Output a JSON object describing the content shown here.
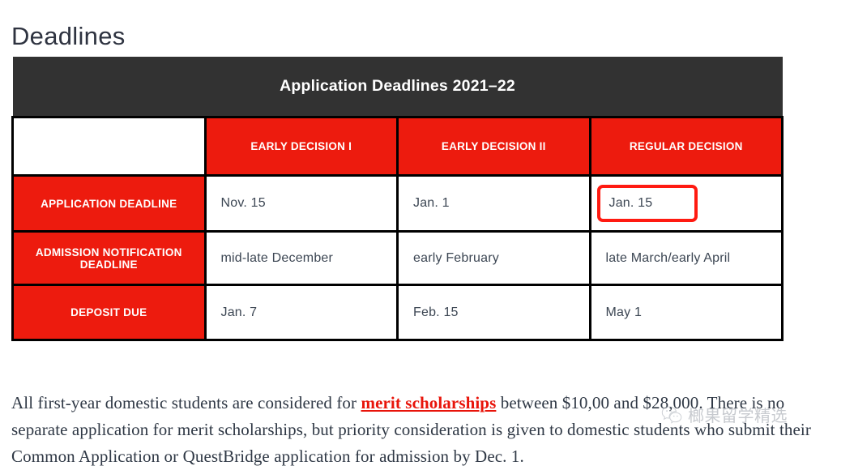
{
  "page": {
    "heading": "Deadlines"
  },
  "table": {
    "caption": "Application Deadlines 2021–22",
    "corner_label": "",
    "columns": [
      "EARLY DECISION I",
      "EARLY DECISION II",
      "REGULAR DECISION"
    ],
    "rows": [
      {
        "label": "APPLICATION DEADLINE",
        "cells": [
          "Nov. 15",
          "Jan. 1",
          "Jan. 15"
        ],
        "highlighted_cell_index": 2
      },
      {
        "label": "ADMISSION NOTIFICATION DEADLINE",
        "cells": [
          "mid-late December",
          "early February",
          "late March/early April"
        ],
        "highlighted_cell_index": -1
      },
      {
        "label": "DEPOSIT DUE",
        "cells": [
          "Jan. 7",
          "Feb. 15",
          "May 1"
        ],
        "highlighted_cell_index": -1
      }
    ],
    "colors": {
      "caption_background": "#323232",
      "header_red": "#ED1B0E",
      "label_red": "#ED1B0E",
      "border": "#000000",
      "highlight_outline": "#FF1A11"
    }
  },
  "paragraph": {
    "part1": "All first-year domestic students are considered for ",
    "link_text": "merit scholarships",
    "part2": " between $10,00 and $28,000. There is no separate application for merit scholarships, but priority consideration is given to domestic students who submit their Common Application or QuestBridge application for admission by Dec. 1.",
    "link_color": "#E8140A"
  },
  "watermark": {
    "icon": "wechat-bubble-icon",
    "text": "榔果留学精选"
  }
}
